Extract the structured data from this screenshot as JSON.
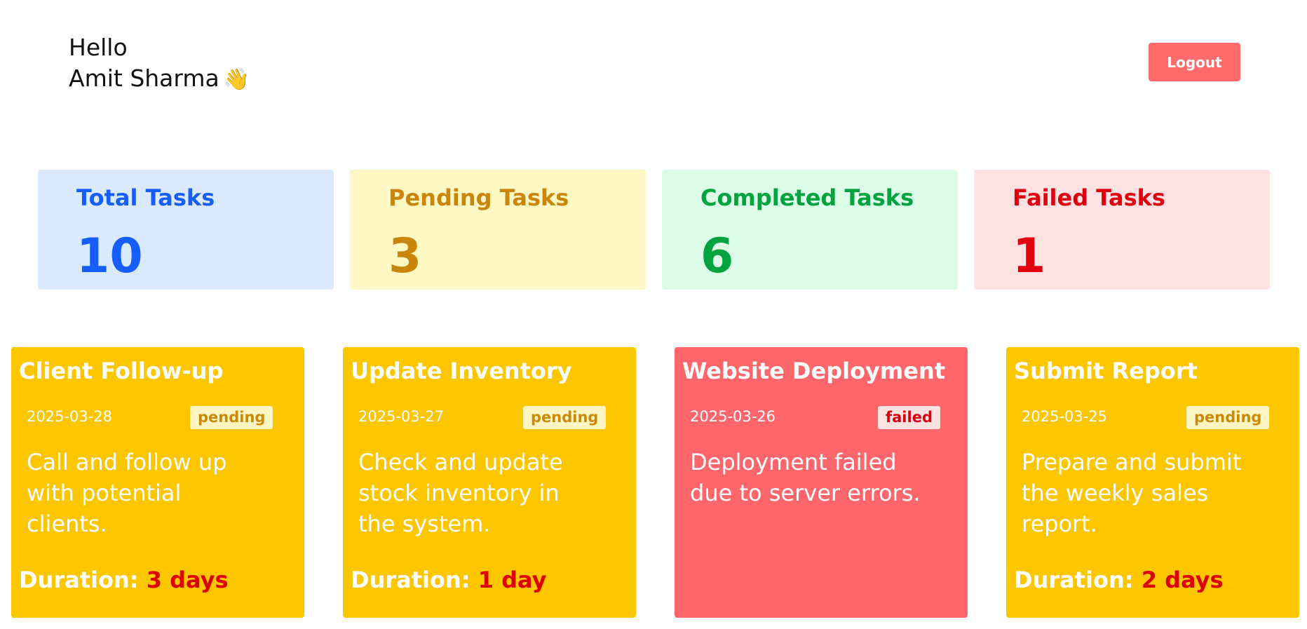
{
  "header": {
    "greeting": "Hello",
    "user_name": "Amit Sharma",
    "wave_emoji": "👋",
    "logout_label": "Logout"
  },
  "stats": [
    {
      "label": "Total Tasks",
      "value": "10",
      "bg": "#dbe9fd",
      "color": "#155dfc"
    },
    {
      "label": "Pending Tasks",
      "value": "3",
      "bg": "#fef8c4",
      "color": "#ca860a"
    },
    {
      "label": "Completed Tasks",
      "value": "6",
      "bg": "#dcfce8",
      "color": "#00a33e"
    },
    {
      "label": "Failed Tasks",
      "value": "1",
      "bg": "#fee2e2",
      "color": "#e00010"
    }
  ],
  "tasks": [
    {
      "title": "Client Follow-up",
      "date": "2025-03-28",
      "status": "pending",
      "description": "Call and follow up with potential clients.",
      "duration_label": "Duration:",
      "duration_value": "3 days",
      "card_color": "#fcc600",
      "status_bg": "#fef6c2",
      "status_color": "#c98a0a"
    },
    {
      "title": "Update Inventory",
      "date": "2025-03-27",
      "status": "pending",
      "description": "Check and update stock inventory in the system.",
      "duration_label": "Duration:",
      "duration_value": "1 day",
      "card_color": "#fcc600",
      "status_bg": "#fef6c2",
      "status_color": "#c98a0a"
    },
    {
      "title": "Website Deployment",
      "date": "2025-03-26",
      "status": "failed",
      "description": "Deployment failed due to server errors.",
      "duration_label": "",
      "duration_value": "",
      "card_color": "#ff666b",
      "status_bg": "#fee2e2",
      "status_color": "#d40010"
    },
    {
      "title": "Submit Report",
      "date": "2025-03-25",
      "status": "pending",
      "description": "Prepare and submit the weekly sales report.",
      "duration_label": "Duration:",
      "duration_value": "2 days",
      "card_color": "#fcc600",
      "status_bg": "#fef6c2",
      "status_color": "#c98a0a"
    }
  ]
}
